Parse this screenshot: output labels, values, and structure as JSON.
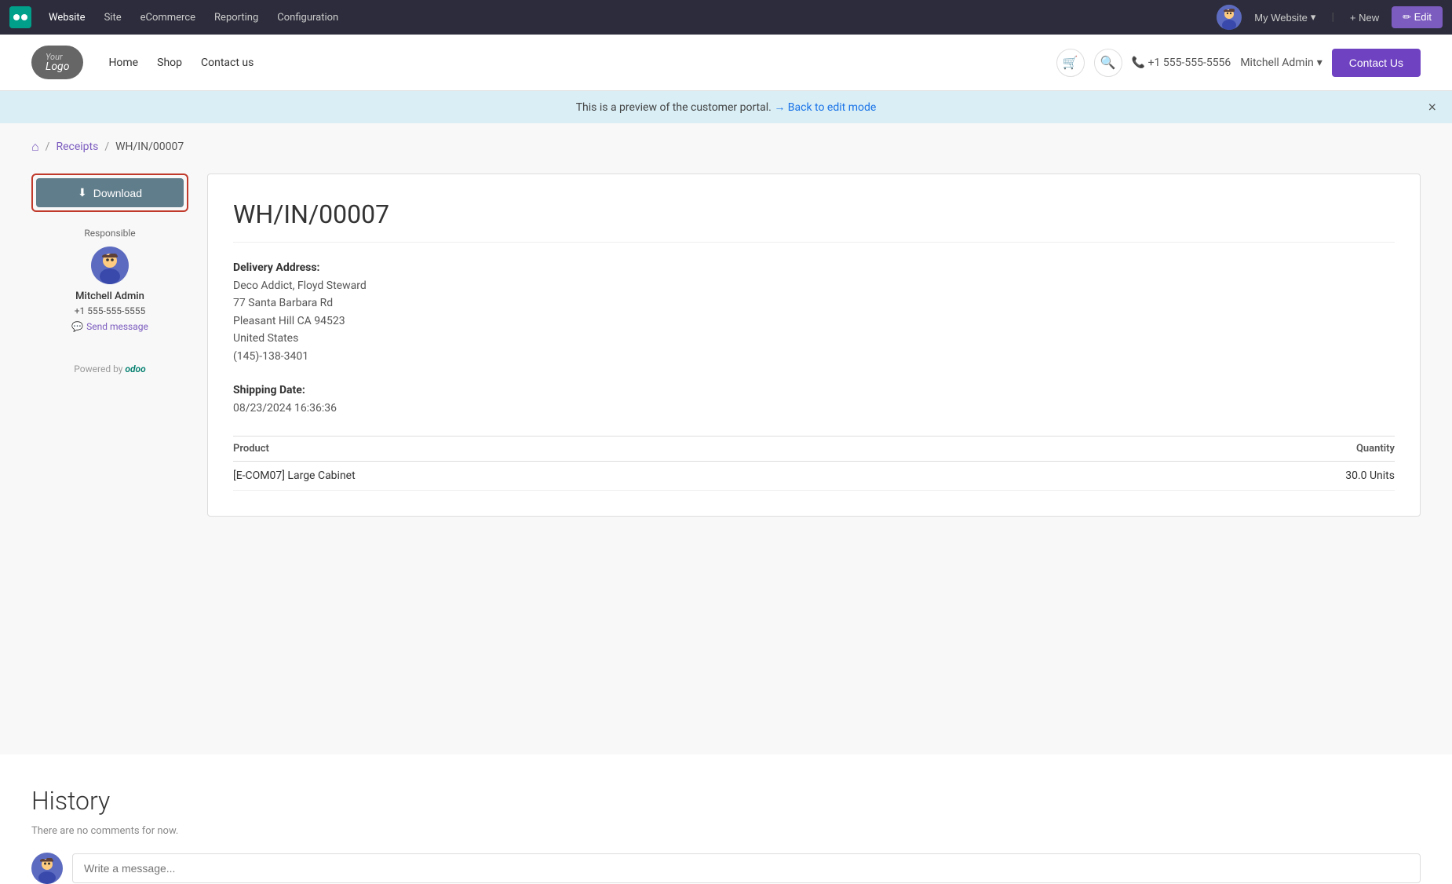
{
  "admin_bar": {
    "logo_text": "O",
    "nav_items": [
      {
        "label": "Website",
        "active": true
      },
      {
        "label": "Site",
        "active": false
      },
      {
        "label": "eCommerce",
        "active": false
      },
      {
        "label": "Reporting",
        "active": false
      },
      {
        "label": "Configuration",
        "active": false
      }
    ],
    "my_website_label": "My Website",
    "new_label": "+ New",
    "edit_label": "✏ Edit"
  },
  "site_nav": {
    "logo_text": "Your Logo",
    "logo_sub": "",
    "links": [
      {
        "label": "Home"
      },
      {
        "label": "Shop"
      },
      {
        "label": "Contact us"
      }
    ],
    "phone": "+1 555-555-5556",
    "user": "Mitchell Admin",
    "contact_us_label": "Contact Us"
  },
  "preview_banner": {
    "text": "This is a preview of the customer portal.",
    "link_text": "→ Back to edit mode",
    "close": "×"
  },
  "breadcrumb": {
    "home_icon": "⌂",
    "items": [
      "Receipts",
      "WH/IN/00007"
    ]
  },
  "sidebar": {
    "download_label": "Download",
    "download_icon": "↓",
    "responsible_label": "Responsible",
    "responsible_name": "Mitchell Admin",
    "responsible_phone": "+1 555-555-5555",
    "send_message_label": "Send message",
    "powered_by": "Powered by",
    "odoo": "odoo"
  },
  "document": {
    "title": "WH/IN/00007",
    "delivery_address_label": "Delivery Address:",
    "delivery_address": "Deco Addict, Floyd Steward\n77 Santa Barbara Rd\nPleasant Hill CA 94523\nUnited States\n(145)-138-3401",
    "delivery_address_line1": "Deco Addict, Floyd Steward",
    "delivery_address_line2": "77 Santa Barbara Rd",
    "delivery_address_line3": "Pleasant Hill CA 94523",
    "delivery_address_line4": "United States",
    "delivery_address_phone": "(145)-138-3401",
    "shipping_date_label": "Shipping Date:",
    "shipping_date": "08/23/2024 16:36:36",
    "table": {
      "col_product": "Product",
      "col_quantity": "Quantity",
      "rows": [
        {
          "product": "[E-COM07] Large Cabinet",
          "quantity": "30.0 Units"
        }
      ]
    }
  },
  "history": {
    "title": "History",
    "empty_text": "There are no comments for now.",
    "compose_placeholder": "Write a message..."
  }
}
